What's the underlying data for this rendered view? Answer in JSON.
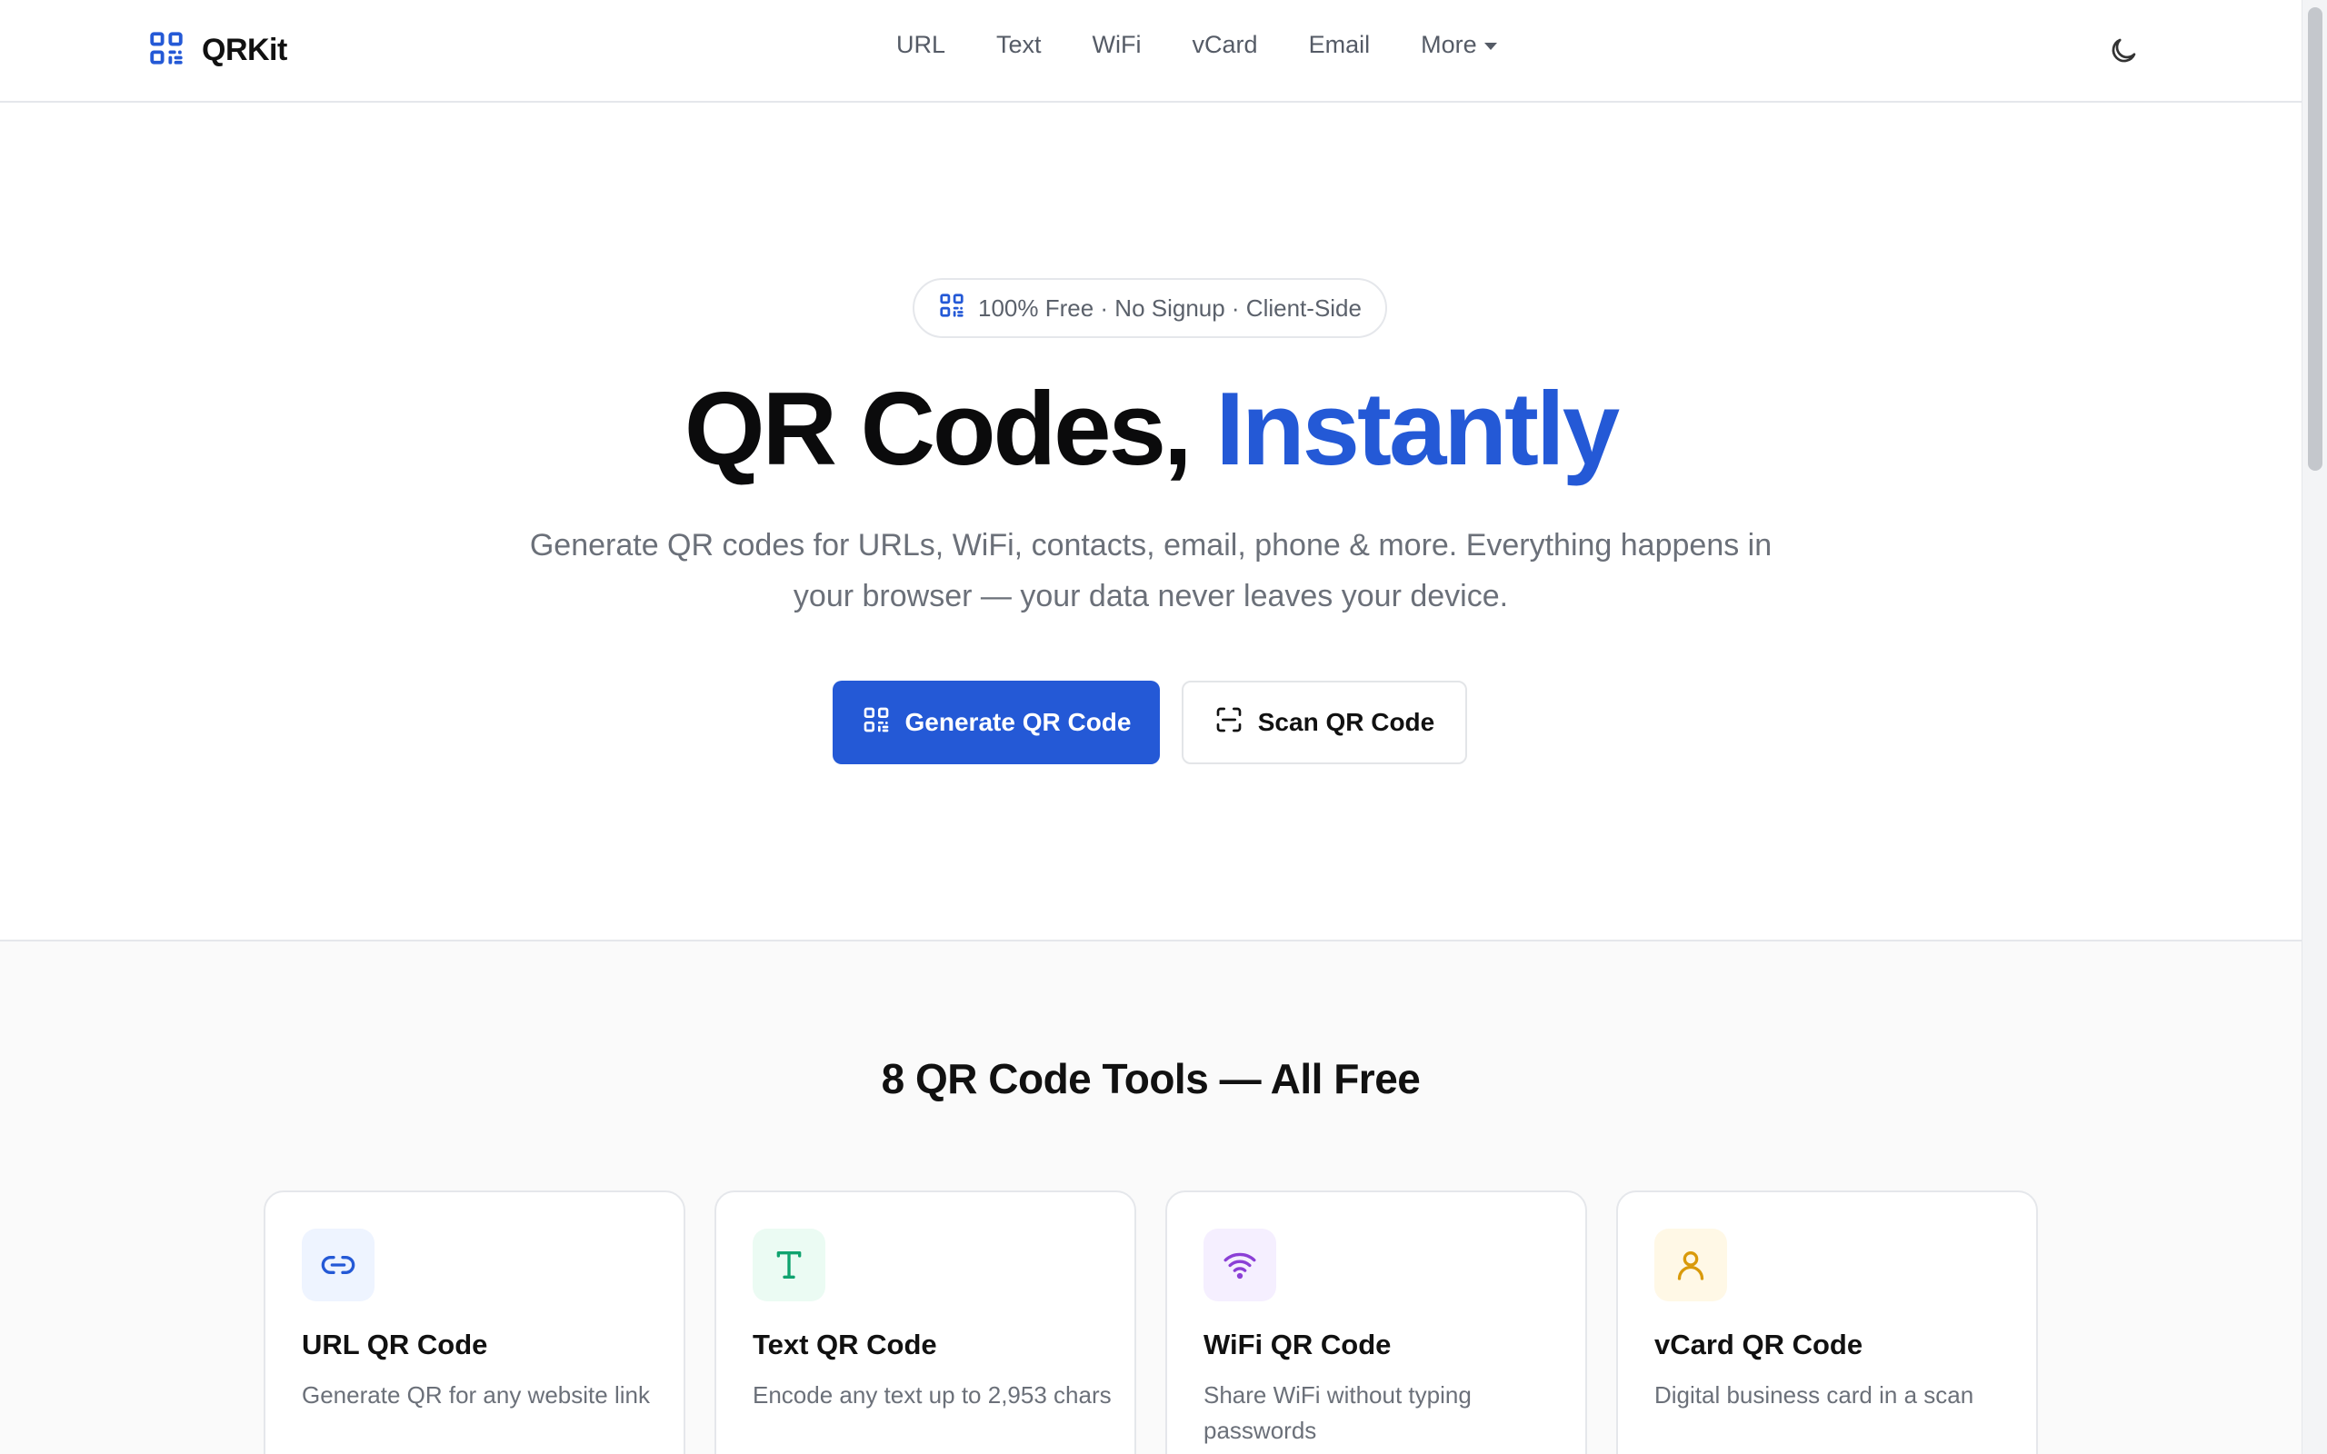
{
  "header": {
    "logo_text": "QRKit",
    "nav": [
      {
        "label": "URL"
      },
      {
        "label": "Text"
      },
      {
        "label": "WiFi"
      },
      {
        "label": "vCard"
      },
      {
        "label": "Email"
      },
      {
        "label": "More"
      }
    ],
    "theme_toggle_icon": "moon-icon"
  },
  "hero": {
    "badge": "100% Free · No Signup · Client-Side",
    "title_main": "QR Codes,",
    "title_accent": "Instantly",
    "subtitle": "Generate QR codes for URLs, WiFi, contacts, email, phone & more. Everything happens in your browser — your data never leaves your device.",
    "primary_button": "Generate QR Code",
    "secondary_button": "Scan QR Code"
  },
  "tools": {
    "title": "8 QR Code Tools — All Free",
    "cards": [
      {
        "title": "URL QR Code",
        "desc": "Generate QR for any website link",
        "icon": "link-icon",
        "color": "#2459d6",
        "bg": "#eef4ff"
      },
      {
        "title": "Text QR Code",
        "desc": "Encode any text up to 2,953 chars",
        "icon": "text-icon",
        "color": "#10a36f",
        "bg": "#ebfbf3"
      },
      {
        "title": "WiFi QR Code",
        "desc": "Share WiFi without typing passwords",
        "icon": "wifi-icon",
        "color": "#8b3fd6",
        "bg": "#f5efff"
      },
      {
        "title": "vCard QR Code",
        "desc": "Digital business card in a scan",
        "icon": "user-icon",
        "color": "#d99a0b",
        "bg": "#fff8e6"
      }
    ]
  },
  "colors": {
    "accent": "#2459d6",
    "text": "#111111",
    "muted": "#6b7079",
    "border": "#e5e7eb"
  }
}
